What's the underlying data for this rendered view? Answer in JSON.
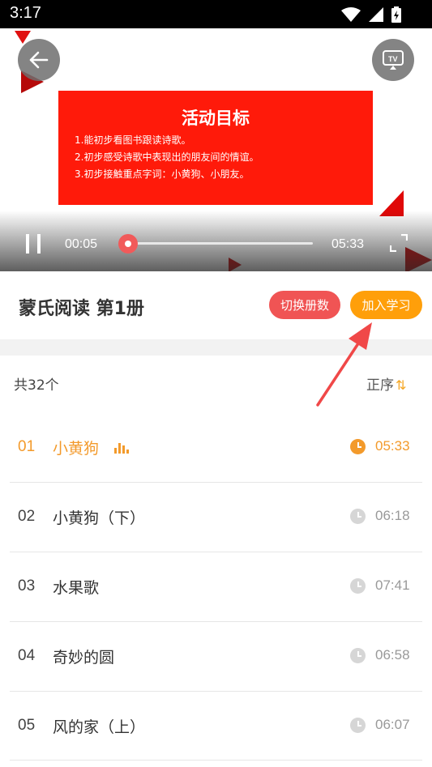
{
  "status_bar": {
    "time": "3:17"
  },
  "video": {
    "slide": {
      "title": "活动目标",
      "lines": [
        "1.能初步看图书跟读诗歌。",
        "2.初步感受诗歌中表现出的朋友间的情谊。",
        "3.初步接触重点字词：小黄狗、小朋友。"
      ]
    },
    "current_time": "00:05",
    "total_time": "05:33",
    "progress": 0.0
  },
  "header": {
    "title": "蒙氏阅读 第1册",
    "switch_label": "切换册数",
    "join_label": "加入学习"
  },
  "list_header": {
    "count": "共32个",
    "sort": "正序"
  },
  "episodes": [
    {
      "num": "01",
      "title": "小黄狗",
      "duration": "05:33",
      "active": true
    },
    {
      "num": "02",
      "title": "小黄狗（下）",
      "duration": "06:18",
      "active": false
    },
    {
      "num": "03",
      "title": "水果歌",
      "duration": "07:41",
      "active": false
    },
    {
      "num": "04",
      "title": "奇妙的圆",
      "duration": "06:58",
      "active": false
    },
    {
      "num": "05",
      "title": "风的家（上）",
      "duration": "06:07",
      "active": false
    }
  ],
  "colors": {
    "accent_orange": "#f39a2b",
    "switch_button": "#f05454",
    "join_button": "#ff9f0a",
    "slide_red": "#ff1a0a",
    "annotation_arrow": "#f04848"
  }
}
